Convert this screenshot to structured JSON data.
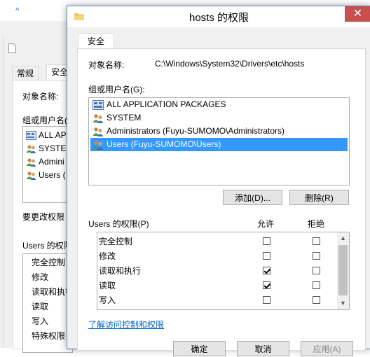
{
  "background_window": {
    "tabs": [
      "常规",
      "安全"
    ],
    "object_name_label": "对象名称:",
    "group_label": "组或用户名(G",
    "users": [
      "ALL AP",
      "SYSTEM",
      "Admini",
      "Users ("
    ],
    "change_perm_label": "要更改权限",
    "perm_label": "Users 的权限",
    "perms": [
      "完全控制",
      "修改",
      "读取和执行",
      "读取",
      "写入",
      "特殊权限"
    ]
  },
  "dialog": {
    "title": "hosts 的权限",
    "close_label": "✕",
    "tab_label": "安全",
    "object_name_label": "对象名称:",
    "object_name_value": "C:\\Windows\\System32\\Drivers\\etc\\hosts",
    "group_label": "组或用户名(G):",
    "users": [
      {
        "name": "ALL APPLICATION PACKAGES",
        "icon": "package-group-icon",
        "selected": false
      },
      {
        "name": "SYSTEM",
        "icon": "users-group-icon",
        "selected": false
      },
      {
        "name": "Administrators (Fuyu-SUMOMO\\Administrators)",
        "icon": "users-group-icon",
        "selected": false
      },
      {
        "name": "Users (Fuyu-SUMOMO\\Users)",
        "icon": "users-group-icon",
        "selected": true
      }
    ],
    "add_button": "添加(D)...",
    "remove_button": "删除(R)",
    "perm_header": "Users 的权限(P)",
    "allow_header": "允许",
    "deny_header": "拒绝",
    "permissions": [
      {
        "name": "完全控制",
        "allow": false,
        "deny": false
      },
      {
        "name": "修改",
        "allow": false,
        "deny": false
      },
      {
        "name": "读取和执行",
        "allow": true,
        "deny": false
      },
      {
        "name": "读取",
        "allow": true,
        "deny": false
      },
      {
        "name": "写入",
        "allow": false,
        "deny": false
      }
    ],
    "learn_link": "了解访问控制和权限",
    "ok_button": "确定",
    "cancel_button": "取消",
    "apply_button": "应用(A)"
  },
  "colors": {
    "selection": "#3399ff",
    "close_button": "#c7504f",
    "link": "#0066cc"
  }
}
